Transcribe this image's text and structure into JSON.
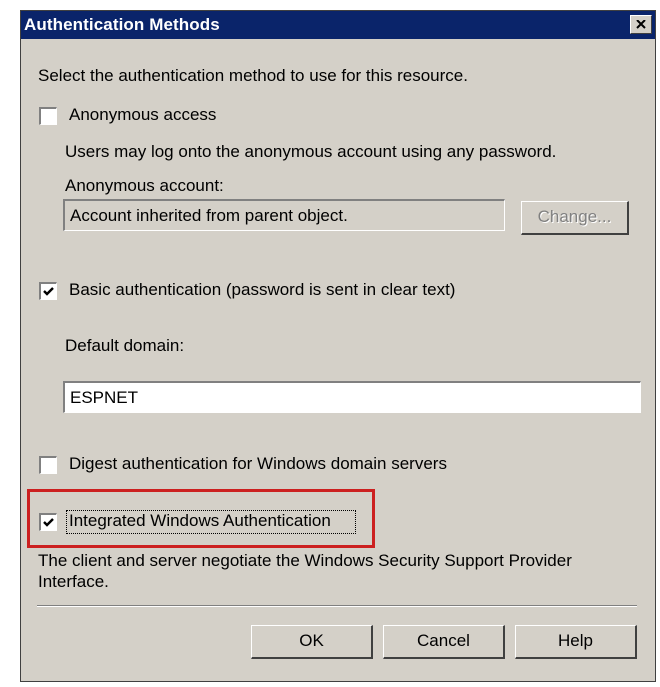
{
  "window": {
    "title": "Authentication Methods"
  },
  "instruction": "Select the authentication method to use for this resource.",
  "anonymous": {
    "label": "Anonymous access",
    "checked": false,
    "description": "Users may log onto the anonymous account using any password.",
    "account_label": "Anonymous account:",
    "account_value": "Account inherited from parent object.",
    "change_label": "Change..."
  },
  "basic": {
    "label": "Basic authentication (password is sent in clear text)",
    "checked": true,
    "domain_label": "Default domain:",
    "domain_value": "ESPNET"
  },
  "digest": {
    "label": "Digest authentication for Windows domain servers",
    "checked": false
  },
  "integrated": {
    "label": "Integrated Windows Authentication",
    "checked": true,
    "description_line1": "The client and server negotiate the Windows Security Support Provider",
    "description_line2": "Interface."
  },
  "buttons": {
    "ok": "OK",
    "cancel": "Cancel",
    "help": "Help"
  },
  "colors": {
    "titlebar": "#0a246a",
    "dialog_bg": "#d4d0c8",
    "highlight": "#cc2020"
  },
  "icons": {
    "close": "close-icon",
    "check": "checkmark-icon"
  }
}
